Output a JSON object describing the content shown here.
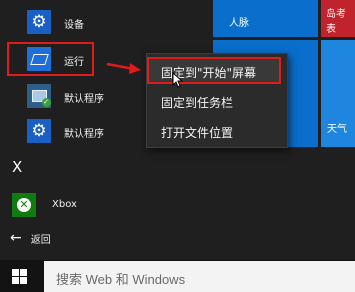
{
  "start_menu": {
    "apps": [
      {
        "label": "设备",
        "icon": "gear-icon"
      },
      {
        "label": "运行",
        "icon": "run-icon"
      },
      {
        "label": "默认程序",
        "icon": "default-programs-icon"
      },
      {
        "label": "默认程序",
        "icon": "gear-icon"
      }
    ],
    "section_letter": "X",
    "xbox": {
      "label": "Xbox",
      "icon": "xbox-icon"
    },
    "back_label": "返回"
  },
  "tiles": {
    "people": "人脉",
    "top_right": "岛考表",
    "weather": "天气"
  },
  "context_menu": {
    "items": [
      "固定到\"开始\"屏幕",
      "固定到任务栏",
      "打开文件位置"
    ]
  },
  "taskbar": {
    "search_placeholder": "搜索 Web 和 Windows"
  },
  "colors": {
    "highlight_red": "#e01b1b",
    "tile_blue": "#0a6fcc",
    "tile_red": "#c0232b",
    "xbox_green": "#107c10"
  }
}
